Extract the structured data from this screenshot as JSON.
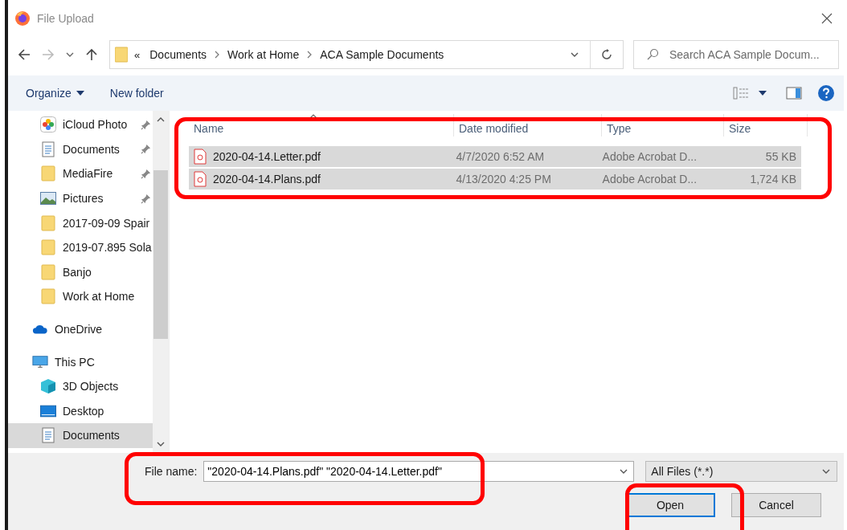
{
  "window": {
    "title": "File Upload"
  },
  "address": {
    "overflow": "«",
    "crumbs": [
      "Documents",
      "Work at Home",
      "ACA Sample Documents"
    ]
  },
  "search": {
    "placeholder": "Search ACA Sample Docum..."
  },
  "toolbar": {
    "buttons": [
      "Organize",
      "New folder"
    ]
  },
  "sidebar": {
    "quick_access": [
      {
        "label": "iCloud Photo",
        "kind": "photos",
        "pinned": true,
        "selected": false
      },
      {
        "label": "Documents",
        "kind": "document",
        "pinned": true,
        "selected": false
      },
      {
        "label": "MediaFire",
        "kind": "folder",
        "pinned": true,
        "selected": false
      },
      {
        "label": "Pictures",
        "kind": "pictures",
        "pinned": true,
        "selected": false
      },
      {
        "label": "2017-09-09 Spair",
        "kind": "folder",
        "pinned": false,
        "selected": false
      },
      {
        "label": "2019-07.895 Sola",
        "kind": "folder",
        "pinned": false,
        "selected": false
      },
      {
        "label": "Banjo",
        "kind": "folder",
        "pinned": false,
        "selected": false
      },
      {
        "label": "Work at Home",
        "kind": "folder",
        "pinned": false,
        "selected": false
      }
    ],
    "items": [
      {
        "label": "OneDrive",
        "kind": "cloud",
        "selected": false
      },
      {
        "label": "This PC",
        "kind": "pc",
        "selected": false,
        "children": [
          {
            "label": "3D Objects",
            "kind": "cube",
            "selected": false
          },
          {
            "label": "Desktop",
            "kind": "desktop",
            "selected": false
          },
          {
            "label": "Documents",
            "kind": "document",
            "selected": true
          }
        ]
      }
    ]
  },
  "table": {
    "columns": [
      "Name",
      "Date modified",
      "Type",
      "Size"
    ],
    "rows": [
      {
        "cells": [
          "2020-04-14.Letter.pdf",
          "4/7/2020 6:52 AM",
          "Adobe Acrobat D...",
          "55 KB"
        ],
        "selected": true
      },
      {
        "cells": [
          "2020-04-14.Plans.pdf",
          "4/13/2020 4:25 PM",
          "Adobe Acrobat D...",
          "1,724 KB"
        ],
        "selected": true
      }
    ]
  },
  "file_name": {
    "label": "File name:",
    "value": "\"2020-04-14.Plans.pdf\" \"2020-04-14.Letter.pdf\""
  },
  "file_type": {
    "value": "All Files (*.*)"
  },
  "buttons": [
    {
      "label": "Open",
      "kind": "default"
    },
    {
      "label": "Cancel",
      "kind": "normal"
    }
  ]
}
